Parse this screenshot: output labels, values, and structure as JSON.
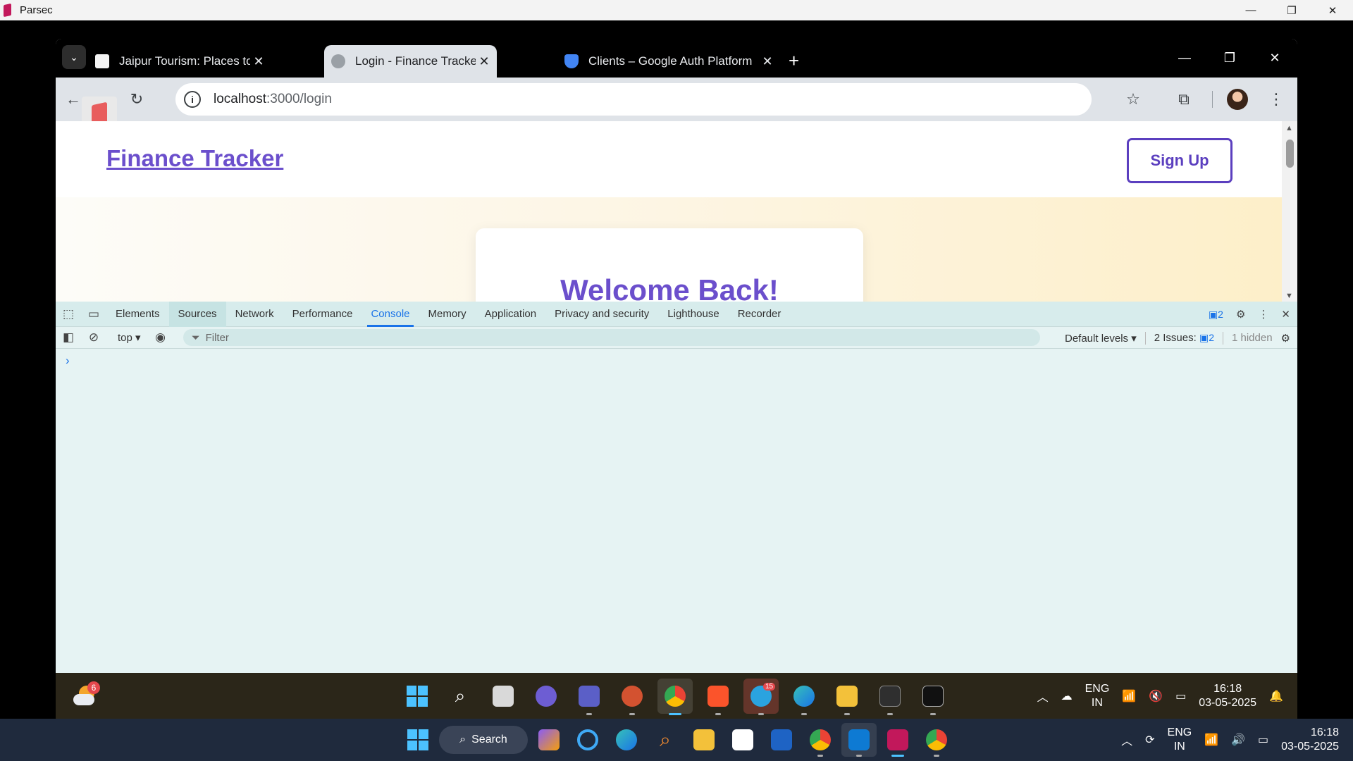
{
  "parsec": {
    "title": "Parsec"
  },
  "tabs": [
    {
      "label": "Jaipur Tourism: Places to Visit, S"
    },
    {
      "label": "Login - Finance Tracker"
    },
    {
      "label": "Clients – Google Auth Platform"
    }
  ],
  "address_bar": {
    "host": "localhost",
    "path": ":3000/login"
  },
  "page": {
    "brand": "Finance Tracker",
    "signup": "Sign Up",
    "heading": "Welcome Back!"
  },
  "devtools": {
    "tabs": [
      "Elements",
      "Sources",
      "Network",
      "Performance",
      "Console",
      "Memory",
      "Application",
      "Privacy and security",
      "Lighthouse",
      "Recorder"
    ],
    "selected_tab": "Console",
    "issues_count": "2",
    "context": "top ▾",
    "filter_placeholder": "Filter",
    "default_levels": "Default levels ▾",
    "issues_label": "2 Issues:",
    "issues_badge": "2",
    "hidden": "1 hidden",
    "prompt": "›"
  },
  "remote_taskbar": {
    "weather_badge": "6",
    "telegram_badge": "15",
    "lang": "ENG",
    "region": "IN",
    "time": "16:18",
    "date": "03-05-2025"
  },
  "local_taskbar": {
    "search_label": "Search",
    "lang": "ENG",
    "region": "IN",
    "time": "16:18",
    "date": "03-05-2025"
  },
  "colors": {
    "brand": "#6b4fcc",
    "accent": "#1a73e8",
    "devtools_bg": "#e6f3f3"
  }
}
